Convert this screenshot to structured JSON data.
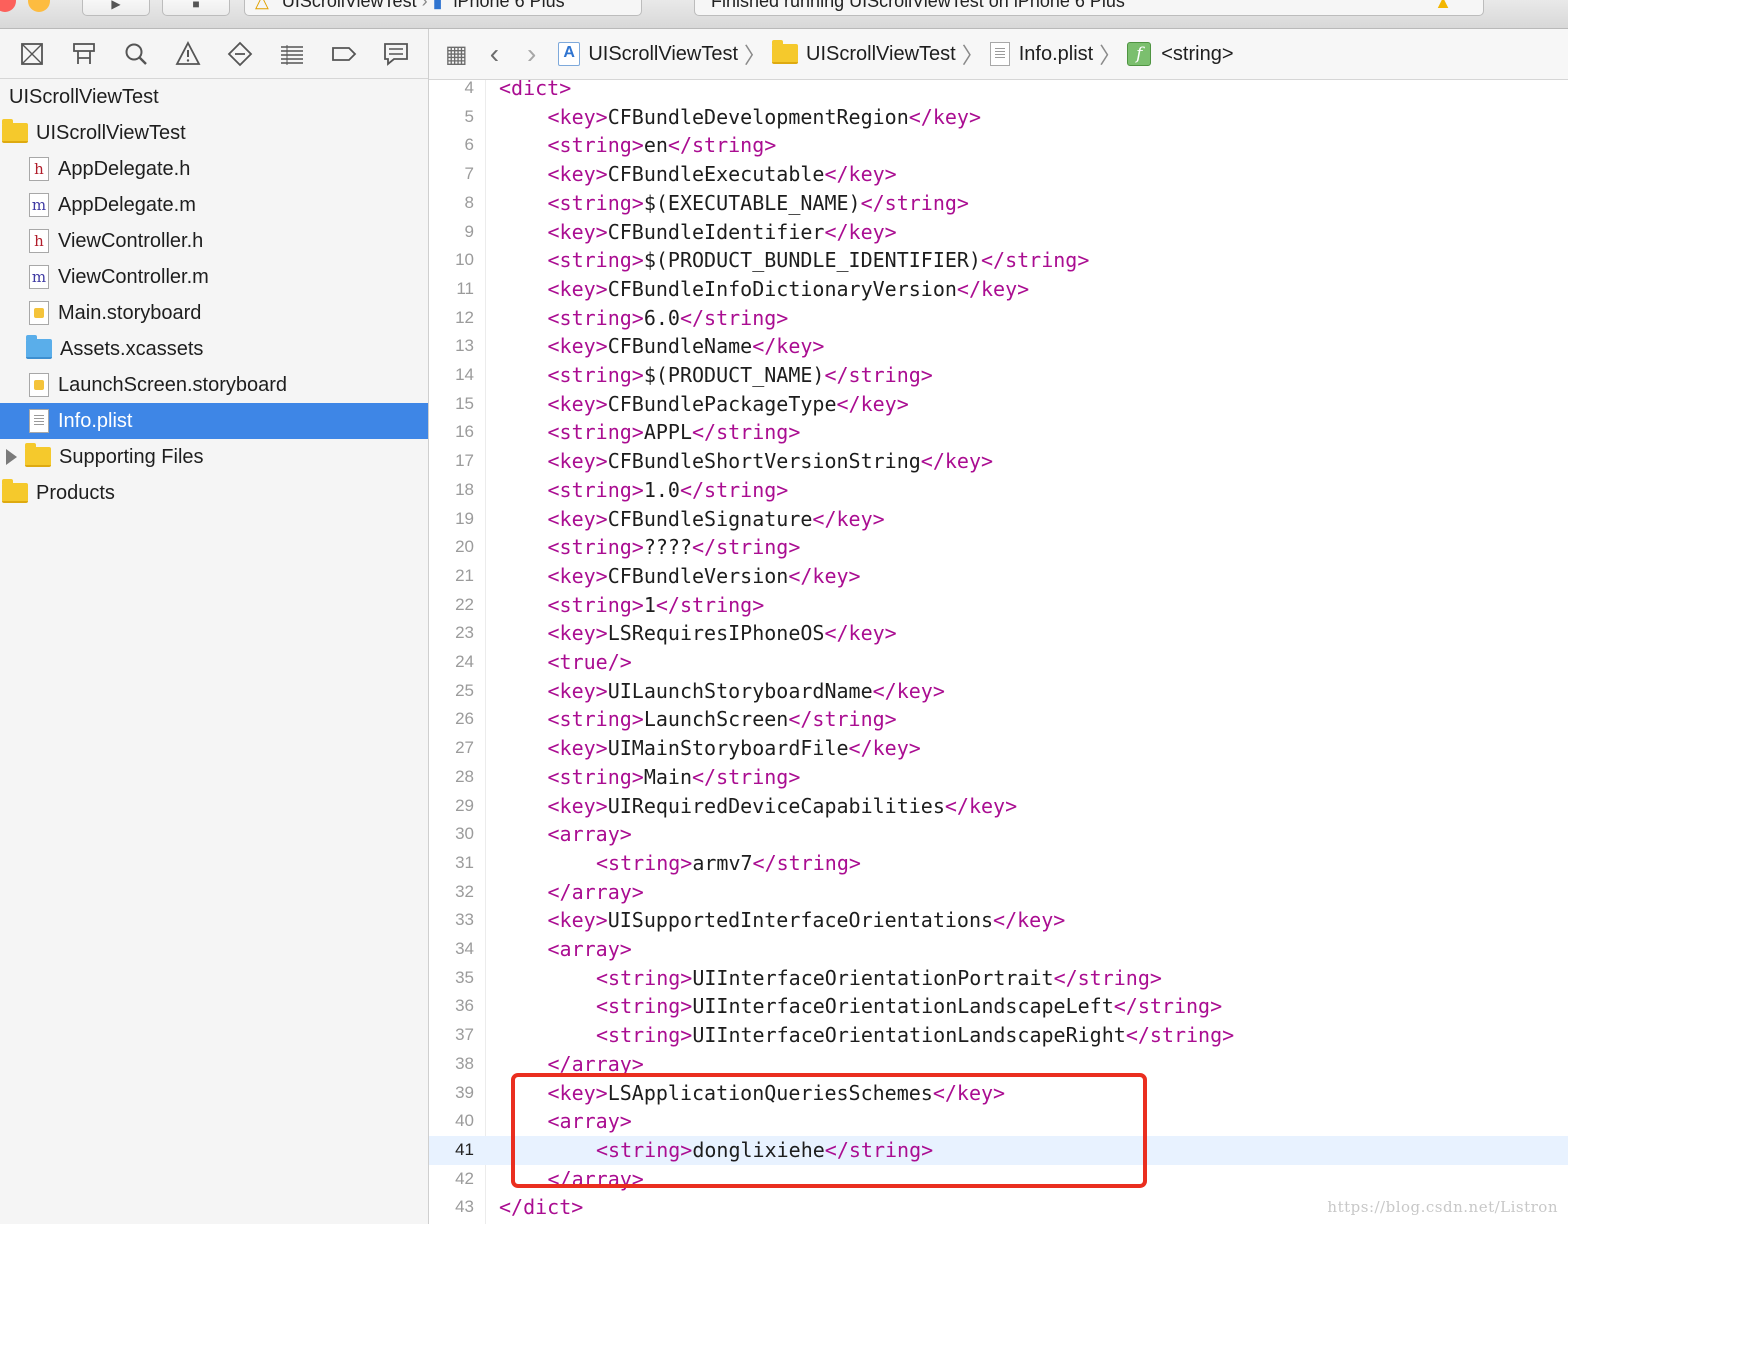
{
  "toolbar": {
    "scheme": "UIScrollViewTest",
    "device": "iPhone 6 Plus",
    "status": "Finished running UIScrollViewTest on iPhone 6 Plus"
  },
  "navigator": {
    "tabs": [
      {
        "name": "project-navigator-icon"
      },
      {
        "name": "symbol-navigator-icon"
      },
      {
        "name": "find-navigator-icon"
      },
      {
        "name": "issue-navigator-icon"
      },
      {
        "name": "test-navigator-icon"
      },
      {
        "name": "debug-navigator-icon"
      },
      {
        "name": "breakpoint-navigator-icon"
      },
      {
        "name": "report-navigator-icon"
      }
    ],
    "items": [
      {
        "label": "UIScrollViewTest",
        "kind": "project"
      },
      {
        "label": "UIScrollViewTest",
        "kind": "folder"
      },
      {
        "label": "AppDelegate.h",
        "kind": "h"
      },
      {
        "label": "AppDelegate.m",
        "kind": "m"
      },
      {
        "label": "ViewController.h",
        "kind": "h"
      },
      {
        "label": "ViewController.m",
        "kind": "m"
      },
      {
        "label": "Main.storyboard",
        "kind": "storyboard"
      },
      {
        "label": "Assets.xcassets",
        "kind": "assets"
      },
      {
        "label": "LaunchScreen.storyboard",
        "kind": "storyboard"
      },
      {
        "label": "Info.plist",
        "kind": "plist",
        "selected": true
      },
      {
        "label": "Supporting Files",
        "kind": "group"
      },
      {
        "label": "Products",
        "kind": "folder"
      }
    ]
  },
  "jumpbar": {
    "crumbs": [
      {
        "label": "UIScrollViewTest",
        "icon": "project-file-icon"
      },
      {
        "label": "UIScrollViewTest",
        "icon": "folder-icon"
      },
      {
        "label": "Info.plist",
        "icon": "plist-file-icon"
      },
      {
        "label": "<string>",
        "icon": "function-icon"
      }
    ]
  },
  "editor": {
    "current_line": 41,
    "lines": [
      {
        "n": "4",
        "indent": 0,
        "parts": [
          [
            "t",
            "<dict>"
          ]
        ]
      },
      {
        "n": "5",
        "indent": 1,
        "parts": [
          [
            "t",
            "<key>"
          ],
          [
            "x",
            "CFBundleDevelopmentRegion"
          ],
          [
            "t",
            "</key>"
          ]
        ]
      },
      {
        "n": "6",
        "indent": 1,
        "parts": [
          [
            "t",
            "<string>"
          ],
          [
            "x",
            "en"
          ],
          [
            "t",
            "</string>"
          ]
        ]
      },
      {
        "n": "7",
        "indent": 1,
        "parts": [
          [
            "t",
            "<key>"
          ],
          [
            "x",
            "CFBundleExecutable"
          ],
          [
            "t",
            "</key>"
          ]
        ]
      },
      {
        "n": "8",
        "indent": 1,
        "parts": [
          [
            "t",
            "<string>"
          ],
          [
            "x",
            "$(EXECUTABLE_NAME)"
          ],
          [
            "t",
            "</string>"
          ]
        ]
      },
      {
        "n": "9",
        "indent": 1,
        "parts": [
          [
            "t",
            "<key>"
          ],
          [
            "x",
            "CFBundleIdentifier"
          ],
          [
            "t",
            "</key>"
          ]
        ]
      },
      {
        "n": "10",
        "indent": 1,
        "parts": [
          [
            "t",
            "<string>"
          ],
          [
            "x",
            "$(PRODUCT_BUNDLE_IDENTIFIER)"
          ],
          [
            "t",
            "</string>"
          ]
        ]
      },
      {
        "n": "11",
        "indent": 1,
        "parts": [
          [
            "t",
            "<key>"
          ],
          [
            "x",
            "CFBundleInfoDictionaryVersion"
          ],
          [
            "t",
            "</key>"
          ]
        ]
      },
      {
        "n": "12",
        "indent": 1,
        "parts": [
          [
            "t",
            "<string>"
          ],
          [
            "x",
            "6.0"
          ],
          [
            "t",
            "</string>"
          ]
        ]
      },
      {
        "n": "13",
        "indent": 1,
        "parts": [
          [
            "t",
            "<key>"
          ],
          [
            "x",
            "CFBundleName"
          ],
          [
            "t",
            "</key>"
          ]
        ]
      },
      {
        "n": "14",
        "indent": 1,
        "parts": [
          [
            "t",
            "<string>"
          ],
          [
            "x",
            "$(PRODUCT_NAME)"
          ],
          [
            "t",
            "</string>"
          ]
        ]
      },
      {
        "n": "15",
        "indent": 1,
        "parts": [
          [
            "t",
            "<key>"
          ],
          [
            "x",
            "CFBundlePackageType"
          ],
          [
            "t",
            "</key>"
          ]
        ]
      },
      {
        "n": "16",
        "indent": 1,
        "parts": [
          [
            "t",
            "<string>"
          ],
          [
            "x",
            "APPL"
          ],
          [
            "t",
            "</string>"
          ]
        ]
      },
      {
        "n": "17",
        "indent": 1,
        "parts": [
          [
            "t",
            "<key>"
          ],
          [
            "x",
            "CFBundleShortVersionString"
          ],
          [
            "t",
            "</key>"
          ]
        ]
      },
      {
        "n": "18",
        "indent": 1,
        "parts": [
          [
            "t",
            "<string>"
          ],
          [
            "x",
            "1.0"
          ],
          [
            "t",
            "</string>"
          ]
        ]
      },
      {
        "n": "19",
        "indent": 1,
        "parts": [
          [
            "t",
            "<key>"
          ],
          [
            "x",
            "CFBundleSignature"
          ],
          [
            "t",
            "</key>"
          ]
        ]
      },
      {
        "n": "20",
        "indent": 1,
        "parts": [
          [
            "t",
            "<string>"
          ],
          [
            "x",
            "????"
          ],
          [
            "t",
            "</string>"
          ]
        ]
      },
      {
        "n": "21",
        "indent": 1,
        "parts": [
          [
            "t",
            "<key>"
          ],
          [
            "x",
            "CFBundleVersion"
          ],
          [
            "t",
            "</key>"
          ]
        ]
      },
      {
        "n": "22",
        "indent": 1,
        "parts": [
          [
            "t",
            "<string>"
          ],
          [
            "x",
            "1"
          ],
          [
            "t",
            "</string>"
          ]
        ]
      },
      {
        "n": "23",
        "indent": 1,
        "parts": [
          [
            "t",
            "<key>"
          ],
          [
            "x",
            "LSRequiresIPhoneOS"
          ],
          [
            "t",
            "</key>"
          ]
        ]
      },
      {
        "n": "24",
        "indent": 1,
        "parts": [
          [
            "t",
            "<true/>"
          ]
        ]
      },
      {
        "n": "25",
        "indent": 1,
        "parts": [
          [
            "t",
            "<key>"
          ],
          [
            "x",
            "UILaunchStoryboardName"
          ],
          [
            "t",
            "</key>"
          ]
        ]
      },
      {
        "n": "26",
        "indent": 1,
        "parts": [
          [
            "t",
            "<string>"
          ],
          [
            "x",
            "LaunchScreen"
          ],
          [
            "t",
            "</string>"
          ]
        ]
      },
      {
        "n": "27",
        "indent": 1,
        "parts": [
          [
            "t",
            "<key>"
          ],
          [
            "x",
            "UIMainStoryboardFile"
          ],
          [
            "t",
            "</key>"
          ]
        ]
      },
      {
        "n": "28",
        "indent": 1,
        "parts": [
          [
            "t",
            "<string>"
          ],
          [
            "x",
            "Main"
          ],
          [
            "t",
            "</string>"
          ]
        ]
      },
      {
        "n": "29",
        "indent": 1,
        "parts": [
          [
            "t",
            "<key>"
          ],
          [
            "x",
            "UIRequiredDeviceCapabilities"
          ],
          [
            "t",
            "</key>"
          ]
        ]
      },
      {
        "n": "30",
        "indent": 1,
        "parts": [
          [
            "t",
            "<array>"
          ]
        ]
      },
      {
        "n": "31",
        "indent": 2,
        "parts": [
          [
            "t",
            "<string>"
          ],
          [
            "x",
            "armv7"
          ],
          [
            "t",
            "</string>"
          ]
        ]
      },
      {
        "n": "32",
        "indent": 1,
        "parts": [
          [
            "t",
            "</array>"
          ]
        ]
      },
      {
        "n": "33",
        "indent": 1,
        "parts": [
          [
            "t",
            "<key>"
          ],
          [
            "x",
            "UISupportedInterfaceOrientations"
          ],
          [
            "t",
            "</key>"
          ]
        ]
      },
      {
        "n": "34",
        "indent": 1,
        "parts": [
          [
            "t",
            "<array>"
          ]
        ]
      },
      {
        "n": "35",
        "indent": 2,
        "parts": [
          [
            "t",
            "<string>"
          ],
          [
            "x",
            "UIInterfaceOrientationPortrait"
          ],
          [
            "t",
            "</string>"
          ]
        ]
      },
      {
        "n": "36",
        "indent": 2,
        "parts": [
          [
            "t",
            "<string>"
          ],
          [
            "x",
            "UIInterfaceOrientationLandscapeLeft"
          ],
          [
            "t",
            "</string>"
          ]
        ]
      },
      {
        "n": "37",
        "indent": 2,
        "parts": [
          [
            "t",
            "<string>"
          ],
          [
            "x",
            "UIInterfaceOrientationLandscapeRight"
          ],
          [
            "t",
            "</string>"
          ]
        ]
      },
      {
        "n": "38",
        "indent": 1,
        "parts": [
          [
            "t",
            "</array>"
          ]
        ]
      },
      {
        "n": "39",
        "indent": 1,
        "parts": [
          [
            "t",
            "<key>"
          ],
          [
            "x",
            "LSApplicationQueriesSchemes"
          ],
          [
            "t",
            "</key>"
          ]
        ]
      },
      {
        "n": "40",
        "indent": 1,
        "parts": [
          [
            "t",
            "<array>"
          ]
        ]
      },
      {
        "n": "41",
        "indent": 2,
        "parts": [
          [
            "t",
            "<string>"
          ],
          [
            "x",
            "donglixiehe"
          ],
          [
            "t",
            "</string>"
          ]
        ]
      },
      {
        "n": "42",
        "indent": 1,
        "parts": [
          [
            "t",
            "</array>"
          ]
        ]
      },
      {
        "n": "43",
        "indent": 0,
        "parts": [
          [
            "t",
            "</dict>"
          ]
        ]
      }
    ]
  },
  "watermark": "https://blog.csdn.net/Listron",
  "colors": {
    "tag": "#aa0d91",
    "selection": "#3e86e6",
    "highlight_box": "#ea2e1f",
    "current_line": "#e8f2ff"
  }
}
